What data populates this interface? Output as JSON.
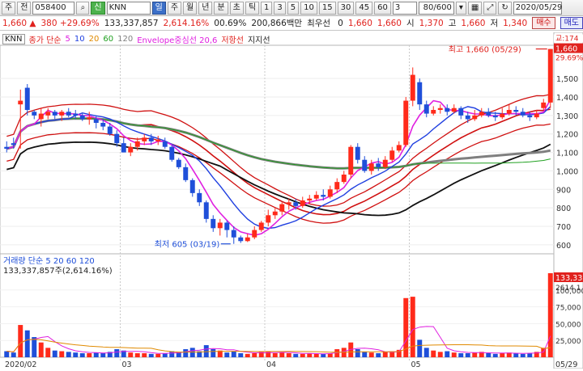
{
  "toolbar": {
    "items": [
      "주",
      "전"
    ],
    "code": "058400",
    "market_icon": "search-icon",
    "name": "KNN",
    "periods": [
      "일",
      "주",
      "월",
      "년",
      "분",
      "초",
      "틱"
    ],
    "active_period": "일",
    "intervals": [
      "1",
      "3",
      "5",
      "10",
      "15",
      "30",
      "45",
      "60"
    ],
    "count_select": "3",
    "view_count": "80/600",
    "date": "2020/05/29"
  },
  "quote": {
    "price": "1,660",
    "change": "380",
    "rate": "+29.69%",
    "volume": "133,337,857",
    "vol_rate": "2,614.16%",
    "turnover": "00.69%",
    "amount": "200,866백만",
    "priority_label": "최우선",
    "priority_value": "0",
    "ask": "1,660",
    "bid": "1,660",
    "open_label": "시",
    "open": "1,370",
    "high_label": "고",
    "high": "1,660",
    "low_label": "저",
    "low": "1,340",
    "buy": "매수",
    "sell": "매도"
  },
  "legend": {
    "name": "KNN",
    "ma_label": "종가 단순",
    "ma_periods": [
      "5",
      "10",
      "20",
      "60",
      "120"
    ],
    "envelope": "Envelope중심선 20,6",
    "resistance": "저항선",
    "support": "지지선"
  },
  "volume_legend": {
    "label": "거래량",
    "ma_label": "단순",
    "ma_periods": [
      "5",
      "20",
      "60",
      "120"
    ],
    "value": "133,337,857주(2,614.16%)"
  },
  "annotations": {
    "high": "최고 1,660 (05/29)",
    "low": "최저 605 (03/19)"
  },
  "price_badges": {
    "last": "1,660",
    "rate": "29.69%",
    "ma": "교:174"
  },
  "volume_badges": {
    "last": "133,33",
    "rate": "2614.1"
  },
  "axis": {
    "price_ticks": [
      "1,500",
      "1,400",
      "1,300",
      "1,200",
      "1,100",
      "1,000",
      "900",
      "800",
      "700",
      "600"
    ],
    "volume_ticks": [
      "100,000",
      "75,000",
      "50,000",
      "25,000"
    ],
    "date_ticks": [
      "2020/02",
      "03",
      "04",
      "05",
      "05/29"
    ]
  },
  "colors": {
    "up": "#ff2a1a",
    "down": "#1f4fd9",
    "ma5": "#e020e0",
    "ma10": "#1f3fe0",
    "ma20": "#e08a00",
    "ma60": "#20a020",
    "ma120": "#7f7f7f",
    "envelope": "#d01010",
    "support": "#111111"
  },
  "chart_data": {
    "type": "candlestick",
    "ylim": [
      560,
      1680
    ],
    "volume_ylim": [
      0,
      125000
    ],
    "dates_months": [
      "2020/02",
      "03",
      "04",
      "05"
    ],
    "candles": [
      [
        1130,
        1120,
        1160,
        1100
      ],
      [
        1150,
        1140,
        1180,
        1120
      ],
      [
        1360,
        1380,
        1440,
        1120
      ],
      [
        1450,
        1330,
        1470,
        1300
      ],
      [
        1320,
        1300,
        1330,
        1280
      ],
      [
        1280,
        1310,
        1340,
        1240
      ],
      [
        1300,
        1320,
        1340,
        1280
      ],
      [
        1320,
        1300,
        1330,
        1280
      ],
      [
        1300,
        1320,
        1330,
        1270
      ],
      [
        1320,
        1300,
        1340,
        1290
      ],
      [
        1310,
        1300,
        1330,
        1280
      ],
      [
        1300,
        1280,
        1310,
        1270
      ],
      [
        1280,
        1290,
        1320,
        1250
      ],
      [
        1280,
        1260,
        1300,
        1230
      ],
      [
        1260,
        1240,
        1280,
        1220
      ],
      [
        1240,
        1200,
        1260,
        1190
      ],
      [
        1200,
        1150,
        1220,
        1130
      ],
      [
        1150,
        1100,
        1180,
        1100
      ],
      [
        1100,
        1130,
        1150,
        1080
      ],
      [
        1130,
        1160,
        1180,
        1110
      ],
      [
        1160,
        1180,
        1200,
        1140
      ],
      [
        1180,
        1160,
        1200,
        1140
      ],
      [
        1160,
        1170,
        1190,
        1140
      ],
      [
        1160,
        1130,
        1180,
        1120
      ],
      [
        1130,
        1060,
        1140,
        1050
      ],
      [
        1060,
        1020,
        1070,
        1010
      ],
      [
        1020,
        950,
        1040,
        940
      ],
      [
        950,
        880,
        960,
        860
      ],
      [
        880,
        830,
        900,
        810
      ],
      [
        830,
        740,
        840,
        720
      ],
      [
        740,
        690,
        760,
        670
      ],
      [
        690,
        720,
        740,
        650
      ],
      [
        720,
        680,
        730,
        640
      ],
      [
        680,
        640,
        700,
        605
      ],
      [
        640,
        620,
        650,
        610
      ],
      [
        620,
        640,
        660,
        615
      ],
      [
        640,
        680,
        700,
        630
      ],
      [
        680,
        720,
        730,
        670
      ],
      [
        720,
        760,
        790,
        700
      ],
      [
        760,
        780,
        800,
        740
      ],
      [
        780,
        820,
        830,
        760
      ],
      [
        820,
        830,
        850,
        790
      ],
      [
        830,
        810,
        850,
        790
      ],
      [
        810,
        840,
        860,
        800
      ],
      [
        840,
        850,
        870,
        820
      ],
      [
        850,
        870,
        890,
        840
      ],
      [
        870,
        860,
        900,
        840
      ],
      [
        860,
        900,
        920,
        850
      ],
      [
        900,
        940,
        960,
        880
      ],
      [
        940,
        980,
        1000,
        930
      ],
      [
        980,
        1130,
        1140,
        960
      ],
      [
        1130,
        1060,
        1150,
        1040
      ],
      [
        1060,
        1000,
        1080,
        990
      ],
      [
        1000,
        1040,
        1060,
        980
      ],
      [
        1040,
        1020,
        1070,
        1000
      ],
      [
        1020,
        1060,
        1080,
        1010
      ],
      [
        1060,
        1110,
        1130,
        1050
      ],
      [
        1110,
        1140,
        1160,
        1100
      ],
      [
        1140,
        1380,
        1400,
        1130
      ],
      [
        1380,
        1520,
        1560,
        1350
      ],
      [
        1480,
        1360,
        1500,
        1330
      ],
      [
        1360,
        1310,
        1380,
        1290
      ],
      [
        1310,
        1330,
        1350,
        1300
      ],
      [
        1330,
        1340,
        1360,
        1310
      ],
      [
        1340,
        1320,
        1360,
        1300
      ],
      [
        1320,
        1340,
        1360,
        1310
      ],
      [
        1340,
        1300,
        1350,
        1280
      ],
      [
        1300,
        1280,
        1320,
        1260
      ],
      [
        1280,
        1300,
        1330,
        1270
      ],
      [
        1300,
        1320,
        1340,
        1290
      ],
      [
        1320,
        1300,
        1340,
        1290
      ],
      [
        1300,
        1290,
        1320,
        1270
      ],
      [
        1290,
        1310,
        1340,
        1280
      ],
      [
        1310,
        1330,
        1360,
        1300
      ],
      [
        1330,
        1320,
        1350,
        1300
      ],
      [
        1320,
        1300,
        1340,
        1290
      ],
      [
        1300,
        1290,
        1320,
        1270
      ],
      [
        1290,
        1310,
        1330,
        1280
      ],
      [
        1340,
        1370,
        1390,
        1330
      ],
      [
        1370,
        1660,
        1660,
        1340
      ]
    ],
    "volumes": [
      9000,
      7000,
      48000,
      40000,
      30000,
      22000,
      14000,
      10000,
      9000,
      8000,
      7000,
      6000,
      6000,
      7000,
      6000,
      8000,
      12000,
      10000,
      7000,
      6000,
      6000,
      5000,
      5000,
      6000,
      9000,
      8000,
      12000,
      14000,
      9000,
      18000,
      12000,
      10000,
      7000,
      9000,
      6000,
      5000,
      6000,
      8000,
      9000,
      6000,
      7000,
      6000,
      5000,
      5000,
      6000,
      5000,
      5000,
      6000,
      12000,
      14000,
      22000,
      12000,
      8000,
      7000,
      6000,
      8000,
      9000,
      11000,
      88000,
      90000,
      26000,
      14000,
      10000,
      8000,
      9000,
      7000,
      6000,
      6000,
      7000,
      8000,
      6000,
      5000,
      6000,
      7000,
      6000,
      5000,
      6000,
      8000,
      14000,
      125000
    ]
  }
}
